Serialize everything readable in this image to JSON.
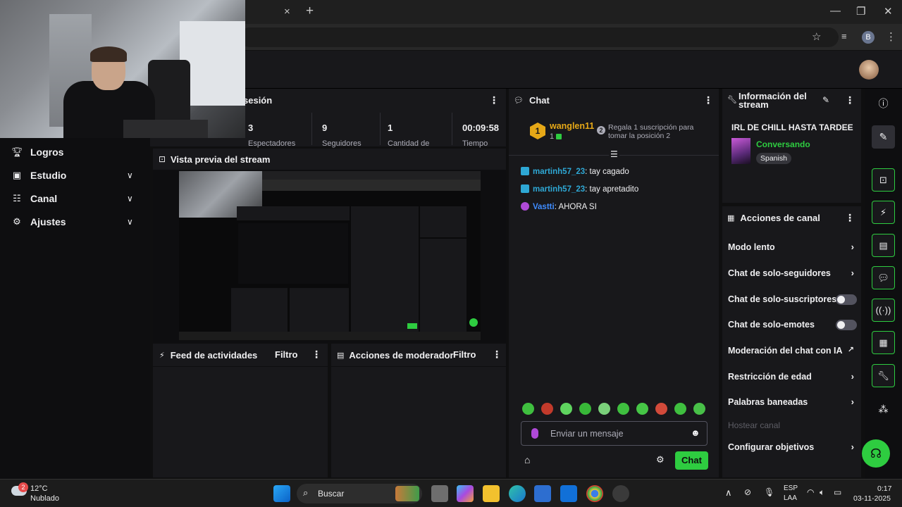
{
  "browser": {
    "tab_close": "×",
    "tab_new": "+",
    "minimize": "—",
    "maximize": "❐",
    "close": "✕",
    "profile_initial": "B"
  },
  "sidebar": {
    "items": [
      {
        "label": "Logros",
        "icon": "trophy-icon"
      },
      {
        "label": "Estudio",
        "icon": "studio-icon"
      },
      {
        "label": "Canal",
        "icon": "channel-icon"
      },
      {
        "label": "Ajustes",
        "icon": "gear-icon"
      }
    ]
  },
  "session": {
    "title": "sesión",
    "stats": [
      {
        "value": "3",
        "caption": "Espectadores"
      },
      {
        "value": "9",
        "caption": "Seguidores"
      },
      {
        "value": "1",
        "caption": "Cantidad de"
      },
      {
        "value": "00:09:58",
        "caption": "Tiempo"
      }
    ]
  },
  "preview": {
    "title": "Vista previa del stream"
  },
  "feed": {
    "title": "Feed de actividades",
    "filter": "Filtro"
  },
  "moderator": {
    "title": "Acciones de moderador",
    "filter": "Filtro"
  },
  "chat": {
    "title": "Chat",
    "top_gifter": {
      "rank": "1",
      "name": "wanglen11",
      "count": "1",
      "next_rank": "2",
      "cta": "Regala 1 suscripción para tomar la posición 2"
    },
    "messages": [
      {
        "user": "martinh57_23",
        "text": ": tay cagado",
        "color": "#2ea8d5"
      },
      {
        "user": "martinh57_23",
        "text": ": tay apretadito",
        "color": "#2ea8d5"
      },
      {
        "user": "Vastti",
        "text": ": AHORA SI",
        "color": "#3f8cff"
      }
    ],
    "input_placeholder": "Enviar un mensaje",
    "send_label": "Chat"
  },
  "info": {
    "title": "Información del stream",
    "stream_title": "IRL DE CHILL HASTA TARDEE",
    "category": "Conversando",
    "language": "Spanish"
  },
  "actions": {
    "title": "Acciones de canal",
    "items": [
      {
        "label": "Modo lento",
        "control": "chevron"
      },
      {
        "label": "Chat de solo-seguidores",
        "control": "chevron"
      },
      {
        "label": "Chat de solo-suscriptores",
        "control": "toggle"
      },
      {
        "label": "Chat de solo-emotes",
        "control": "toggle"
      },
      {
        "label": "Moderación del chat con IA",
        "control": "external"
      },
      {
        "label": "Restricción de edad",
        "control": "chevron"
      },
      {
        "label": "Palabras baneadas",
        "control": "chevron"
      },
      {
        "label": "Hostear canal",
        "control": "disabled"
      },
      {
        "label": "Configurar objetivos",
        "control": "chevron"
      }
    ]
  },
  "taskbar": {
    "weather_temp": "12°C",
    "weather_desc": "Nublado",
    "weather_badge": "2",
    "search_label": "Buscar",
    "lang_top": "ESP",
    "lang_bottom": "LAA",
    "time": "0:17",
    "date": "03-11-2025"
  },
  "colors": {
    "accent": "#2ecc40",
    "panel": "#18181b",
    "background": "#0e0e10"
  }
}
